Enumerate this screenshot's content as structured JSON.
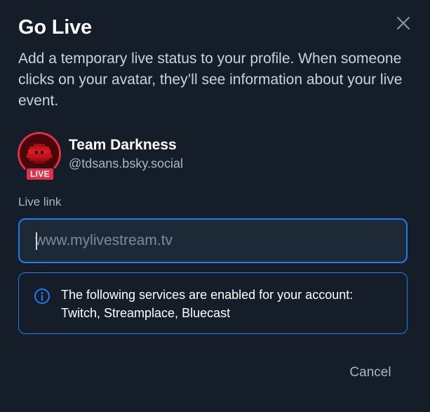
{
  "dialog": {
    "title": "Go Live",
    "description": "Add a temporary live status to your profile. When someone clicks on your avatar, they’ll see information about your live event.",
    "close_icon": "close-icon"
  },
  "profile": {
    "display_name": "Team Darkness",
    "handle": "@tdsans.bsky.social",
    "live_badge": "LIVE"
  },
  "form": {
    "live_link_label": "Live link",
    "live_link_value": "",
    "live_link_placeholder": "www.mylivestream.tv"
  },
  "info": {
    "icon": "info-icon",
    "text": "The following services are enabled for your account: Twitch, Streamplace, Bluecast"
  },
  "actions": {
    "cancel_label": "Cancel"
  },
  "colors": {
    "background": "#151d28",
    "accent": "#1d7cf2",
    "live": "#e0304a",
    "muted_text": "#a9b6c4"
  }
}
